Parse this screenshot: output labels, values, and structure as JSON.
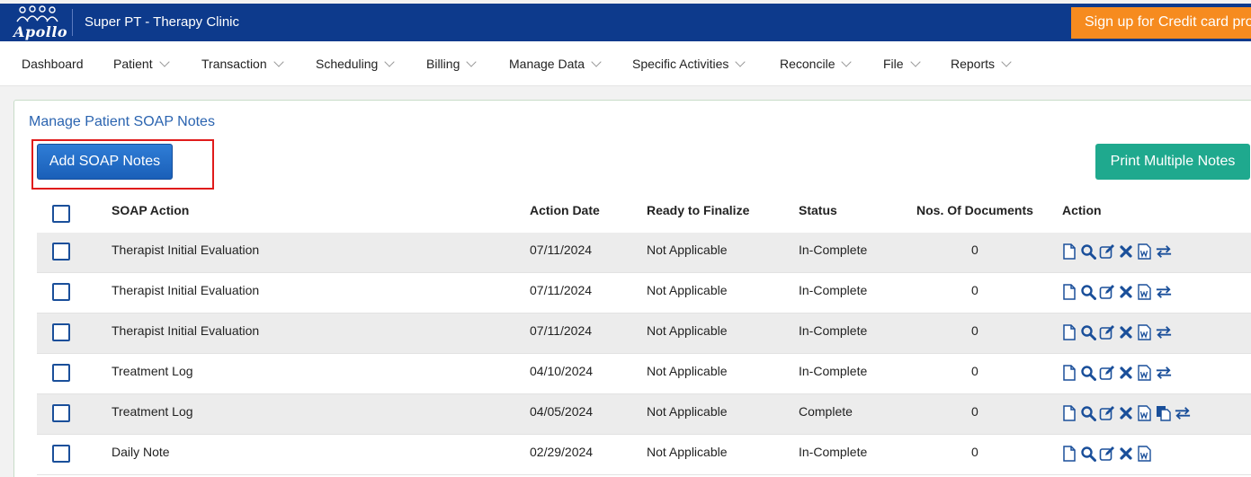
{
  "app": {
    "logo_text": "Apollo",
    "clinic_name": "Super PT - Therapy Clinic",
    "promo_text": "Sign up for Credit card processing"
  },
  "nav": {
    "items": [
      {
        "label": "Dashboard",
        "dropdown": false
      },
      {
        "label": "Patient",
        "dropdown": true
      },
      {
        "label": "Transaction",
        "dropdown": true
      },
      {
        "label": "Scheduling",
        "dropdown": true
      },
      {
        "label": "Billing",
        "dropdown": true
      },
      {
        "label": "Manage Data",
        "dropdown": true
      },
      {
        "label": "Specific Activities",
        "dropdown": true
      },
      {
        "label": "Reconcile",
        "dropdown": true
      },
      {
        "label": "File",
        "dropdown": true
      },
      {
        "label": "Reports",
        "dropdown": true
      }
    ]
  },
  "page": {
    "title": "Manage Patient SOAP Notes",
    "add_button": "Add SOAP Notes",
    "print_button": "Print Multiple Notes"
  },
  "table": {
    "headers": {
      "soap_action": "SOAP Action",
      "action_date": "Action Date",
      "ready": "Ready to Finalize",
      "status": "Status",
      "docs": "Nos. Of Documents",
      "action": "Action"
    },
    "rows": [
      {
        "soap_action": "Therapist Initial Evaluation",
        "date": "07/11/2024",
        "ready": "Not Applicable",
        "status": "In-Complete",
        "docs": "0",
        "icons": [
          "document-icon",
          "search-icon",
          "edit-icon",
          "delete-icon",
          "word-icon",
          "transfer-icon"
        ]
      },
      {
        "soap_action": "Therapist Initial Evaluation",
        "date": "07/11/2024",
        "ready": "Not Applicable",
        "status": "In-Complete",
        "docs": "0",
        "icons": [
          "document-icon",
          "search-icon",
          "edit-icon",
          "delete-icon",
          "word-icon",
          "transfer-icon"
        ]
      },
      {
        "soap_action": "Therapist Initial Evaluation",
        "date": "07/11/2024",
        "ready": "Not Applicable",
        "status": "In-Complete",
        "docs": "0",
        "icons": [
          "document-icon",
          "search-icon",
          "edit-icon",
          "delete-icon",
          "word-icon",
          "transfer-icon"
        ]
      },
      {
        "soap_action": "Treatment Log",
        "date": "04/10/2024",
        "ready": "Not Applicable",
        "status": "In-Complete",
        "docs": "0",
        "icons": [
          "document-icon",
          "search-icon",
          "edit-icon",
          "delete-icon",
          "word-icon",
          "transfer-icon"
        ]
      },
      {
        "soap_action": "Treatment Log",
        "date": "04/05/2024",
        "ready": "Not Applicable",
        "status": "Complete",
        "docs": "0",
        "icons": [
          "document-icon",
          "search-icon",
          "edit-icon",
          "delete-icon",
          "word-icon",
          "copy-icon",
          "transfer-icon"
        ]
      },
      {
        "soap_action": "Daily Note",
        "date": "02/29/2024",
        "ready": "Not Applicable",
        "status": "In-Complete",
        "docs": "0",
        "icons": [
          "document-icon",
          "search-icon",
          "edit-icon",
          "delete-icon",
          "word-icon"
        ]
      }
    ]
  },
  "colors": {
    "header_bg": "#0d3a8c",
    "promo_bg": "#f68b1f",
    "primary_button": "#1a5fb8",
    "print_button": "#1fa98e",
    "title_link": "#2b64b0",
    "icon_blue": "#1a4f9a",
    "highlight": "#e01b1b"
  }
}
